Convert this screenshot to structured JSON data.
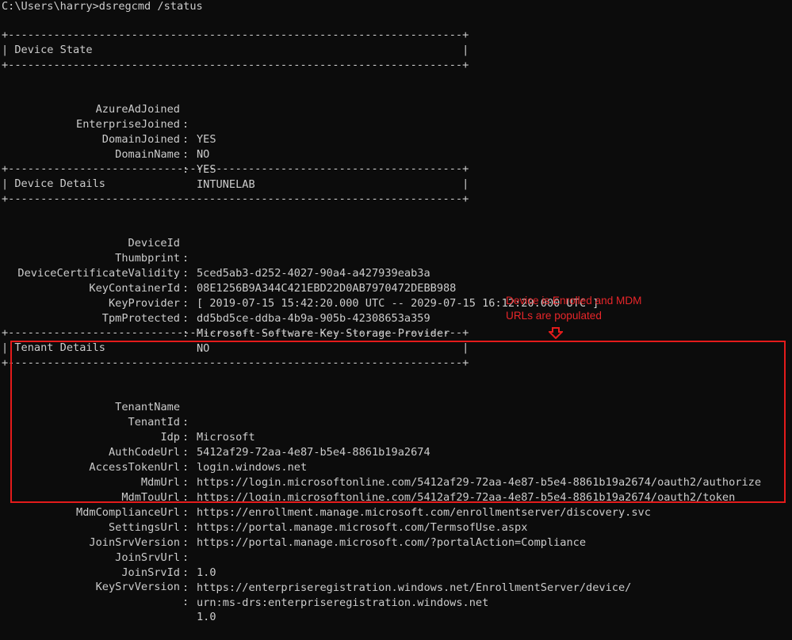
{
  "prompt_line": "C:\\Users\\harry>dsregcmd /status",
  "border_line": "+----------------------------------------------------------------------+",
  "sections": {
    "device_state": {
      "title": "| Device State                                                         |",
      "rows": [
        {
          "key": "AzureAdJoined",
          "value": "YES"
        },
        {
          "key": "EnterpriseJoined",
          "value": "NO"
        },
        {
          "key": "DomainJoined",
          "value": "YES"
        },
        {
          "key": "DomainName",
          "value": "INTUNELAB"
        }
      ]
    },
    "device_details": {
      "title": "| Device Details                                                       |",
      "rows": [
        {
          "key": "DeviceId",
          "value": "5ced5ab3-d252-4027-90a4-a427939eab3a"
        },
        {
          "key": "Thumbprint",
          "value": "08E1256B9A344C421EBD22D0AB7970472DEBB988"
        },
        {
          "key": "DeviceCertificateValidity",
          "value": "[ 2019-07-15 15:42:20.000 UTC -- 2029-07-15 16:12:20.000 UTC ]"
        },
        {
          "key": "KeyContainerId",
          "value": "dd5bd5ce-ddba-4b9a-905b-42308653a359"
        },
        {
          "key": "KeyProvider",
          "value": "Microsoft Software Key Storage Provider"
        },
        {
          "key": "TpmProtected",
          "value": "NO"
        }
      ]
    },
    "tenant_details": {
      "title": "| Tenant Details                                                       |",
      "rows": [
        {
          "key": "TenantName",
          "value": "Microsoft"
        },
        {
          "key": "TenantId",
          "value": "5412af29-72aa-4e87-b5e4-8861b19a2674"
        },
        {
          "key": "Idp",
          "value": "login.windows.net"
        },
        {
          "key": "AuthCodeUrl",
          "value": "https://login.microsoftonline.com/5412af29-72aa-4e87-b5e4-8861b19a2674/oauth2/authorize"
        },
        {
          "key": "AccessTokenUrl",
          "value": "https://login.microsoftonline.com/5412af29-72aa-4e87-b5e4-8861b19a2674/oauth2/token"
        },
        {
          "key": "MdmUrl",
          "value": "https://enrollment.manage.microsoft.com/enrollmentserver/discovery.svc"
        },
        {
          "key": "MdmTouUrl",
          "value": "https://portal.manage.microsoft.com/TermsofUse.aspx"
        },
        {
          "key": "MdmComplianceUrl",
          "value": "https://portal.manage.microsoft.com/?portalAction=Compliance"
        },
        {
          "key": "SettingsUrl",
          "value": ""
        },
        {
          "key": "JoinSrvVersion",
          "value": "1.0"
        },
        {
          "key": "JoinSrvUrl",
          "value": "https://enterpriseregistration.windows.net/EnrollmentServer/device/"
        },
        {
          "key": "JoinSrvId",
          "value": "urn:ms-drs:enterpriseregistration.windows.net"
        },
        {
          "key": "KeySrvVersion",
          "value": "1.0"
        }
      ]
    }
  },
  "separator": ":",
  "annotation": {
    "line1": "Device is Enrolled and MDM",
    "line2": "URLs are populated",
    "color": "#e8262a"
  },
  "colors": {
    "background": "#0c0c0c",
    "text": "#cccccc",
    "highlight_border": "#e41b1b"
  }
}
